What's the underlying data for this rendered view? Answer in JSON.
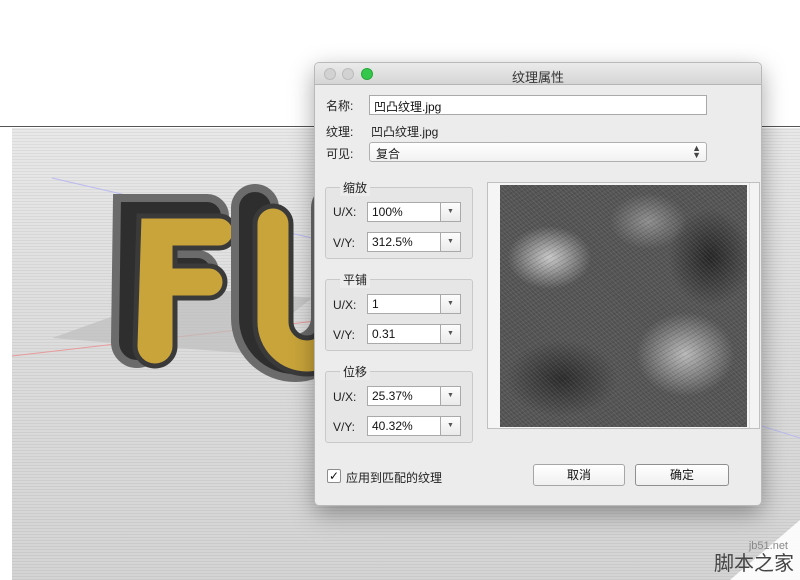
{
  "scene": {
    "text": "FU"
  },
  "dialog": {
    "title": "纹理属性",
    "name_label": "名称:",
    "name_value": "凹凸纹理.jpg",
    "texture_label": "纹理:",
    "texture_value": "凹凸纹理.jpg",
    "visible_label": "可见:",
    "visible_value": "复合",
    "scale": {
      "title": "缩放",
      "ux_label": "U/X:",
      "ux_value": "100%",
      "vy_label": "V/Y:",
      "vy_value": "312.5%"
    },
    "tile": {
      "title": "平铺",
      "ux_label": "U/X:",
      "ux_value": "1",
      "vy_label": "V/Y:",
      "vy_value": "0.31"
    },
    "offset": {
      "title": "位移",
      "ux_label": "U/X:",
      "ux_value": "25.37%",
      "vy_label": "V/Y:",
      "vy_value": "40.32%"
    },
    "apply_label": "应用到匹配的纹理",
    "apply_checked": "✓",
    "cancel_label": "取消",
    "ok_label": "确定"
  },
  "watermark": {
    "site": "jb51.net",
    "text": "脚本之家"
  },
  "icons": {
    "close": "close-dot",
    "minimize": "minimize-dot",
    "maximize": "maximize-dot"
  },
  "colors": {
    "maximize": "#34c84a",
    "gold": "#c9a43a"
  }
}
